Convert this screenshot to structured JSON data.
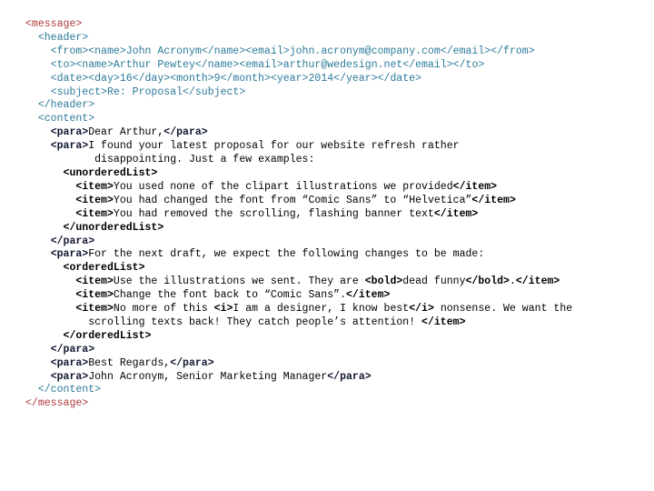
{
  "document": {
    "kind": "xml-source-listing",
    "background_color": "#ffffff",
    "colors": {
      "root_tag": "#b03a3a",
      "structure_tag": "#2b7a99",
      "field_tag": "#2b7a99",
      "para_tag": "#111833",
      "list_tag": "#000000",
      "body_text": "#000000"
    }
  },
  "lines": [
    {
      "id": "line-1",
      "indent": 0,
      "segments": [
        {
          "kind": "root",
          "text": "<message>"
        }
      ]
    },
    {
      "id": "line-2",
      "indent": 2,
      "segments": [
        {
          "kind": "struct",
          "text": "<header>"
        }
      ]
    },
    {
      "id": "line-3",
      "indent": 4,
      "segments": [
        {
          "kind": "field",
          "text": "<from><name>"
        },
        {
          "kind": "fieldtext",
          "text": "John Acronym"
        },
        {
          "kind": "field",
          "text": "</name><email>"
        },
        {
          "kind": "fieldtext",
          "text": "john.acronym@company.com"
        },
        {
          "kind": "field",
          "text": "</email></from>"
        }
      ]
    },
    {
      "id": "line-4",
      "indent": 4,
      "segments": [
        {
          "kind": "field",
          "text": "<to><name>"
        },
        {
          "kind": "fieldtext",
          "text": "Arthur Pewtey"
        },
        {
          "kind": "field",
          "text": "</name><email>"
        },
        {
          "kind": "fieldtext",
          "text": "arthur@wedesign.net"
        },
        {
          "kind": "field",
          "text": "</email></to>"
        }
      ]
    },
    {
      "id": "line-5",
      "indent": 4,
      "segments": [
        {
          "kind": "field",
          "text": "<date><day>"
        },
        {
          "kind": "fieldtext",
          "text": "16"
        },
        {
          "kind": "field",
          "text": "</day><month>"
        },
        {
          "kind": "fieldtext",
          "text": "9"
        },
        {
          "kind": "field",
          "text": "</month><year>"
        },
        {
          "kind": "fieldtext",
          "text": "2014"
        },
        {
          "kind": "field",
          "text": "</year></date>"
        }
      ]
    },
    {
      "id": "line-6",
      "indent": 4,
      "segments": [
        {
          "kind": "field",
          "text": "<subject>"
        },
        {
          "kind": "fieldtext",
          "text": "Re: Proposal"
        },
        {
          "kind": "field",
          "text": "</subject>"
        }
      ]
    },
    {
      "id": "line-7",
      "indent": 2,
      "segments": [
        {
          "kind": "struct",
          "text": "</header>"
        }
      ]
    },
    {
      "id": "line-8",
      "indent": 2,
      "segments": [
        {
          "kind": "struct",
          "text": "<content>"
        }
      ]
    },
    {
      "id": "line-9",
      "indent": 4,
      "segments": [
        {
          "kind": "para",
          "text": "<para>"
        },
        {
          "kind": "text",
          "text": "Dear Arthur,"
        },
        {
          "kind": "para",
          "text": "</para>"
        }
      ]
    },
    {
      "id": "line-10",
      "indent": 4,
      "segments": [
        {
          "kind": "para",
          "text": "<para>"
        },
        {
          "kind": "text",
          "text": "I found your latest proposal for our website refresh rather"
        }
      ]
    },
    {
      "id": "line-11",
      "indent": 11,
      "segments": [
        {
          "kind": "text",
          "text": "disappointing. Just a few examples:"
        }
      ]
    },
    {
      "id": "line-12",
      "indent": 6,
      "segments": [
        {
          "kind": "list",
          "text": "<unorderedList>"
        }
      ]
    },
    {
      "id": "line-13",
      "indent": 8,
      "segments": [
        {
          "kind": "item",
          "text": "<item>"
        },
        {
          "kind": "text",
          "text": "You used none of the clipart illustrations we provided"
        },
        {
          "kind": "item",
          "text": "</item>"
        }
      ]
    },
    {
      "id": "line-14",
      "indent": 8,
      "segments": [
        {
          "kind": "item",
          "text": "<item>"
        },
        {
          "kind": "text",
          "text": "You had changed the font from “Comic Sans” to “Helvetica”"
        },
        {
          "kind": "item",
          "text": "</item>"
        }
      ]
    },
    {
      "id": "line-15",
      "indent": 8,
      "segments": [
        {
          "kind": "item",
          "text": "<item>"
        },
        {
          "kind": "text",
          "text": "You had removed the scrolling, flashing banner text"
        },
        {
          "kind": "item",
          "text": "</item>"
        }
      ]
    },
    {
      "id": "line-16",
      "indent": 6,
      "segments": [
        {
          "kind": "list",
          "text": "</unorderedList>"
        }
      ]
    },
    {
      "id": "line-17",
      "indent": 4,
      "segments": [
        {
          "kind": "para",
          "text": "</para>"
        }
      ]
    },
    {
      "id": "line-18",
      "indent": 4,
      "segments": [
        {
          "kind": "para",
          "text": "<para>"
        },
        {
          "kind": "text",
          "text": "For the next draft, we expect the following changes to be made:"
        }
      ]
    },
    {
      "id": "line-19",
      "indent": 6,
      "segments": [
        {
          "kind": "list",
          "text": "<orderedList>"
        }
      ]
    },
    {
      "id": "line-20",
      "indent": 8,
      "segments": [
        {
          "kind": "item",
          "text": "<item>"
        },
        {
          "kind": "text",
          "text": "Use the illustrations we sent. They are "
        },
        {
          "kind": "inline",
          "text": "<bold>"
        },
        {
          "kind": "text",
          "text": "dead funny"
        },
        {
          "kind": "inline",
          "text": "</bold>"
        },
        {
          "kind": "text",
          "text": "."
        },
        {
          "kind": "item",
          "text": "</item>"
        }
      ]
    },
    {
      "id": "line-21",
      "indent": 8,
      "segments": [
        {
          "kind": "item",
          "text": "<item>"
        },
        {
          "kind": "text",
          "text": "Change the font back to “Comic Sans”."
        },
        {
          "kind": "item",
          "text": "</item>"
        }
      ]
    },
    {
      "id": "line-22",
      "indent": 8,
      "segments": [
        {
          "kind": "item",
          "text": "<item>"
        },
        {
          "kind": "text",
          "text": "No more of this "
        },
        {
          "kind": "inline",
          "text": "<i>"
        },
        {
          "kind": "text",
          "text": "I am a designer, I know best"
        },
        {
          "kind": "inline",
          "text": "</i>"
        },
        {
          "kind": "text",
          "text": " nonsense. We want the"
        }
      ]
    },
    {
      "id": "line-23",
      "indent": 10,
      "segments": [
        {
          "kind": "text",
          "text": "scrolling texts back! They catch people’s attention! "
        },
        {
          "kind": "item",
          "text": "</item>"
        }
      ]
    },
    {
      "id": "line-24",
      "indent": 6,
      "segments": [
        {
          "kind": "list",
          "text": "</orderedList>"
        }
      ]
    },
    {
      "id": "line-25",
      "indent": 4,
      "segments": [
        {
          "kind": "para",
          "text": "</para>"
        }
      ]
    },
    {
      "id": "line-26",
      "indent": 4,
      "segments": [
        {
          "kind": "para",
          "text": "<para>"
        },
        {
          "kind": "text",
          "text": "Best Regards,"
        },
        {
          "kind": "para",
          "text": "</para>"
        }
      ]
    },
    {
      "id": "line-27",
      "indent": 4,
      "segments": [
        {
          "kind": "para",
          "text": "<para>"
        },
        {
          "kind": "text",
          "text": "John Acronym, Senior Marketing Manager"
        },
        {
          "kind": "para",
          "text": "</para>"
        }
      ]
    },
    {
      "id": "line-28",
      "indent": 2,
      "segments": [
        {
          "kind": "struct",
          "text": "</content>"
        }
      ]
    },
    {
      "id": "line-29",
      "indent": 0,
      "segments": [
        {
          "kind": "root",
          "text": "</message>"
        }
      ]
    }
  ]
}
